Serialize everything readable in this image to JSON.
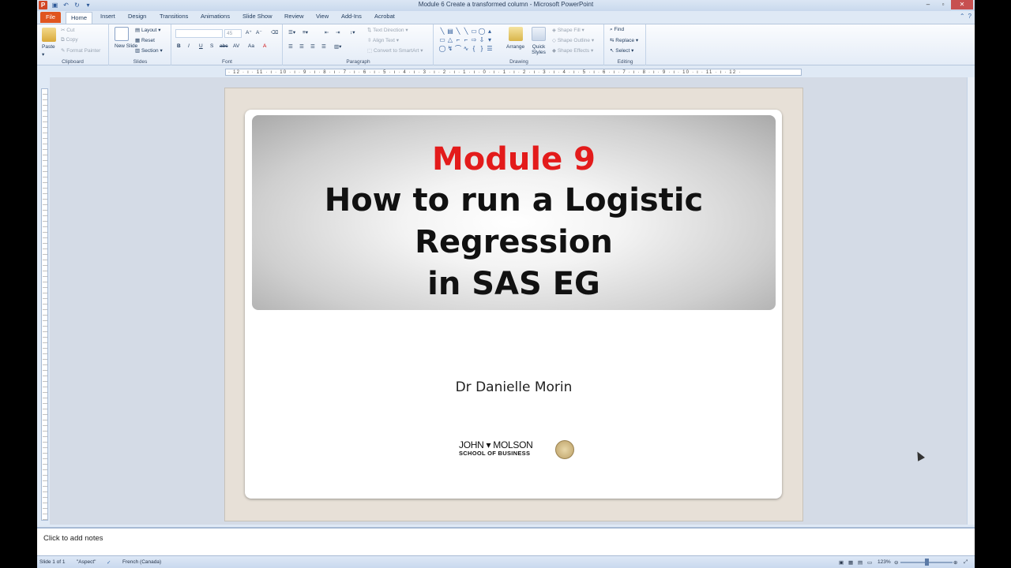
{
  "window": {
    "title": "Module 6 Create a transformed column  -  Microsoft PowerPoint",
    "app_icon": "P"
  },
  "tabs": [
    "File",
    "Home",
    "Insert",
    "Design",
    "Transitions",
    "Animations",
    "Slide Show",
    "Review",
    "View",
    "Add-Ins",
    "Acrobat"
  ],
  "ribbon": {
    "clipboard": {
      "paste": "Paste",
      "cut": "Cut",
      "copy": "Copy",
      "format_painter": "Format Painter",
      "label": "Clipboard"
    },
    "slides": {
      "new_slide": "New Slide",
      "layout": "Layout",
      "reset": "Reset",
      "section": "Section",
      "label": "Slides"
    },
    "font": {
      "size": "45",
      "label": "Font",
      "bold": "B",
      "italic": "I",
      "underline": "U",
      "shadow": "S",
      "strike": "abc",
      "spacing": "AV",
      "case": "Aa",
      "color": "A"
    },
    "paragraph": {
      "text_direction": "Text Direction",
      "align_text": "Align Text",
      "smartart": "Convert to SmartArt",
      "label": "Paragraph"
    },
    "drawing": {
      "arrange": "Arrange",
      "quick_styles": "Quick Styles",
      "shape_fill": "Shape Fill",
      "shape_outline": "Shape Outline",
      "shape_effects": "Shape Effects",
      "label": "Drawing"
    },
    "editing": {
      "find": "Find",
      "replace": "Replace",
      "select": "Select",
      "label": "Editing"
    }
  },
  "ruler": "· 12 · ı · 11 · ı · 10 · ı · 9 · ı · 8 · ı · 7 · ı · 6 · ı · 5 · ı · 4 · ı · 3 · ı · 2 · ı · 1 · ı · 0 · ı · 1 · ı · 2 · ı · 3 · ı · 4 · ı · 5 · ı · 6 · ı · 7 · ı · 8 · ı · 9 · ı · 10 · ı · 11 · ı · 12 ·",
  "slide": {
    "title_line1": "Module 9",
    "title_line2": "How to run a Logistic",
    "title_line3": "Regression",
    "title_line4": "in SAS EG",
    "subtitle": "Dr Danielle Morin",
    "logo_line1": "JOHN ▾ MOLSON",
    "logo_line2": "SCHOOL OF BUSINESS"
  },
  "notes": {
    "placeholder": "Click to add notes"
  },
  "statusbar": {
    "slide_count": "Slide 1 of 1",
    "theme": "\"Aspect\"",
    "language": "French (Canada)",
    "zoom": "123%"
  },
  "colors": {
    "title_red": "#e31b1b",
    "file_tab": "#e0551f",
    "ribbon_bg": "#dfe9f5"
  }
}
